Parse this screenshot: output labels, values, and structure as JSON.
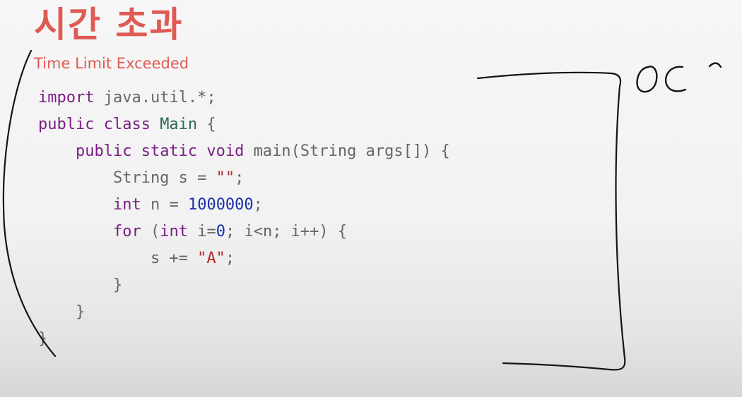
{
  "slide": {
    "title": "시간 초과",
    "subtitle": "Time Limit Exceeded"
  },
  "code": {
    "lines": [
      [
        {
          "t": "import",
          "c": "kw"
        },
        {
          "t": " java.util.*;",
          "c": "plain"
        }
      ],
      [
        {
          "t": "public class ",
          "c": "kw"
        },
        {
          "t": "Main",
          "c": "cls"
        },
        {
          "t": " {",
          "c": "plain"
        }
      ],
      [
        {
          "t": "    ",
          "c": "plain"
        },
        {
          "t": "public static void ",
          "c": "kw"
        },
        {
          "t": "main(String args[]) {",
          "c": "plain"
        }
      ],
      [
        {
          "t": "        String s = ",
          "c": "plain"
        },
        {
          "t": "\"\"",
          "c": "str"
        },
        {
          "t": ";",
          "c": "plain"
        }
      ],
      [
        {
          "t": "        ",
          "c": "plain"
        },
        {
          "t": "int",
          "c": "kw"
        },
        {
          "t": " n = ",
          "c": "plain"
        },
        {
          "t": "1000000",
          "c": "num"
        },
        {
          "t": ";",
          "c": "plain"
        }
      ],
      [
        {
          "t": "        ",
          "c": "plain"
        },
        {
          "t": "for",
          "c": "kw"
        },
        {
          "t": " (",
          "c": "plain"
        },
        {
          "t": "int",
          "c": "kw"
        },
        {
          "t": " i=",
          "c": "plain"
        },
        {
          "t": "0",
          "c": "num"
        },
        {
          "t": "; i<n; i++) {",
          "c": "plain"
        }
      ],
      [
        {
          "t": "            s += ",
          "c": "plain"
        },
        {
          "t": "\"A\"",
          "c": "str"
        },
        {
          "t": ";",
          "c": "plain"
        }
      ],
      [
        {
          "t": "        }",
          "c": "plain"
        }
      ],
      [
        {
          "t": "    }",
          "c": "plain"
        }
      ],
      [
        {
          "t": "}",
          "c": "plain"
        }
      ]
    ]
  },
  "annotation": {
    "handwriting": "OC"
  },
  "colors": {
    "title": "#e05a55",
    "keyword": "#7a1f85",
    "class_name": "#2f6a55",
    "string": "#b22a2a",
    "number": "#1a2fa8",
    "plain": "#666666",
    "ink": "#141414"
  }
}
